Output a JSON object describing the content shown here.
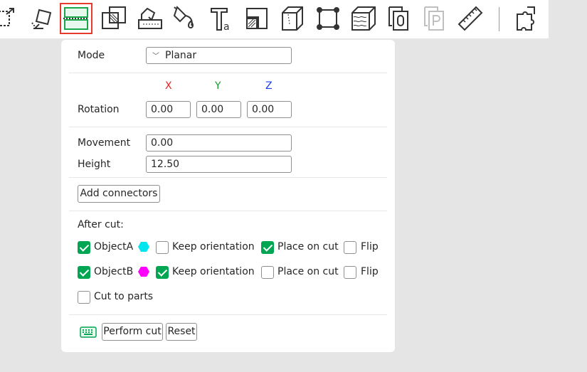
{
  "toolbar": {
    "active_tool": "cut",
    "active_outline_color": "#e53b2a",
    "tools": [
      "scale-icon",
      "place-on-face-icon",
      "cut-icon",
      "boolean-icon",
      "support-paint-icon",
      "seam-paint-icon",
      "color-paint-icon",
      "text-icon",
      "emboss-icon",
      "measure-volume-icon",
      "simplify-icon",
      "variable-layer-height-icon",
      "text-shape-icon",
      "svg-icon",
      "measure-icon",
      "assembly-icon"
    ]
  },
  "mode": {
    "label": "Mode",
    "value": "Planar"
  },
  "axes": {
    "x": "X",
    "y": "Y",
    "z": "Z",
    "x_color": "#e8221f",
    "y_color": "#149f2e",
    "z_color": "#1a3ee8"
  },
  "rotation": {
    "label": "Rotation",
    "x": "0.00",
    "y": "0.00",
    "z": "0.00"
  },
  "movement": {
    "label": "Movement",
    "value": "0.00"
  },
  "height": {
    "label": "Height",
    "value": "12.50"
  },
  "add_connectors": "Add connectors",
  "after_cut": {
    "label": "After cut:",
    "object_a": {
      "name": "ObjectA",
      "checked": true,
      "color": "#00e5ee",
      "keep_orientation": {
        "label": "Keep orientation",
        "checked": false
      },
      "place_on_cut": {
        "label": "Place on cut",
        "checked": true
      },
      "flip": {
        "label": "Flip",
        "checked": false
      }
    },
    "object_b": {
      "name": "ObjectB",
      "checked": true,
      "color": "#ff00ff",
      "keep_orientation": {
        "label": "Keep orientation",
        "checked": true
      },
      "place_on_cut": {
        "label": "Place on cut",
        "checked": false
      },
      "flip": {
        "label": "Flip",
        "checked": false
      }
    },
    "cut_to_parts": {
      "label": "Cut to parts",
      "checked": false
    }
  },
  "actions": {
    "perform_cut": "Perform cut",
    "reset": "Reset"
  },
  "accent_color": "#00a651"
}
